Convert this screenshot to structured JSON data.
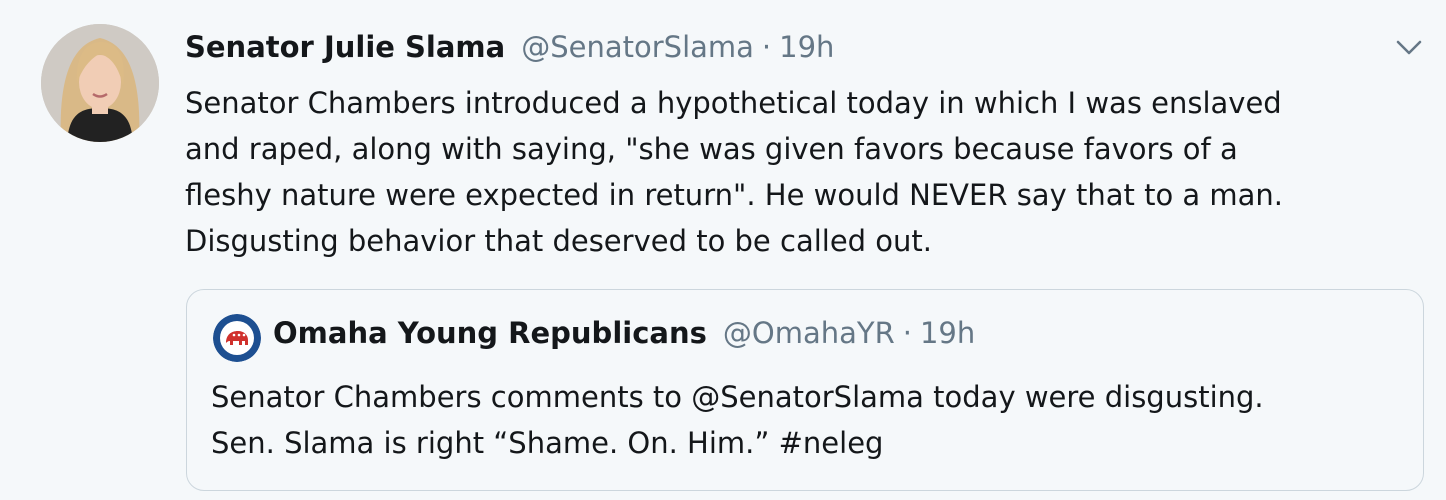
{
  "tweet": {
    "author_name": "Senator Julie Slama",
    "handle": "@SenatorSlama",
    "separator": "·",
    "time": "19h",
    "text_lines": [
      "Senator Chambers introduced a hypothetical today in which I was enslaved",
      "and raped, along with saying, \"she was given favors because favors of a",
      "fleshy nature were expected in return\". He would NEVER say that to a man.",
      "Disgusting behavior that deserved to be called out."
    ],
    "menu_icon": "chevron-down-icon"
  },
  "quoted_tweet": {
    "author_name": "Omaha Young Republicans",
    "handle": "@OmahaYR",
    "separator": "·",
    "time": "19h",
    "text_lines": [
      "Senator Chambers comments to @SenatorSlama today were disgusting.",
      "Sen. Slama is right “Shame. On. Him.” #neleg"
    ]
  },
  "colors": {
    "background": "#f5f8fa",
    "text": "#14171a",
    "secondary_text": "#657786",
    "border": "#ccd6dd",
    "quote_logo_blue": "#1d4f91",
    "quote_logo_red": "#d0312d"
  }
}
